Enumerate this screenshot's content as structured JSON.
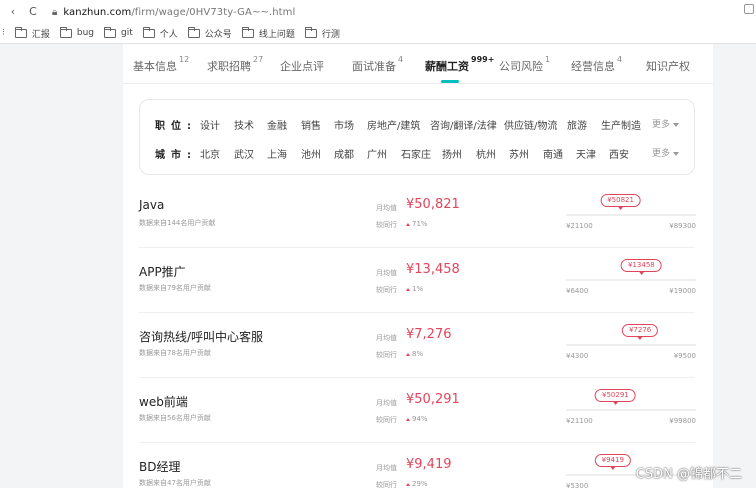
{
  "browser": {
    "back_glyph": "‹",
    "reload_glyph": "C",
    "url_host": "kanzhun.com",
    "url_path": "/firm/wage/0HV73ty-GA~~.html",
    "apps_label": "⁝",
    "bookmarks": [
      "汇报",
      "bug",
      "git",
      "个人",
      "公众号",
      "线上问题",
      "行测"
    ]
  },
  "tabs": [
    {
      "label": "基本信息",
      "count": "12"
    },
    {
      "label": "求职招聘",
      "count": "27"
    },
    {
      "label": "企业点评",
      "count": ""
    },
    {
      "label": "面试准备",
      "count": "4"
    },
    {
      "label": "薪酬工资",
      "count": "999+"
    },
    {
      "label": "公司风险",
      "count": "1"
    },
    {
      "label": "经营信息",
      "count": "4"
    },
    {
      "label": "知识产权",
      "count": ""
    }
  ],
  "active_tab_index": 4,
  "filters": {
    "position_label": "职位:",
    "positions": [
      "设计",
      "技术",
      "金融",
      "销售",
      "市场",
      "房地产/建筑",
      "咨询/翻译/法律",
      "供应链/物流",
      "旅游",
      "生产制造"
    ],
    "city_label": "城市:",
    "cities": [
      "北京",
      "武汉",
      "上海",
      "池州",
      "成都",
      "广州",
      "石家庄",
      "扬州",
      "杭州",
      "苏州",
      "南通",
      "天津",
      "西安"
    ],
    "more_label": "更多"
  },
  "salary_rows": [
    {
      "job": "Java",
      "source": "数据来自144名用户贡献",
      "avg_label": "月均值",
      "avg": "¥50,821",
      "yoy_label": "较同行",
      "yoy": "71%",
      "bubble": "¥50821",
      "min": "¥21100",
      "max": "¥89300",
      "level": 0.42
    },
    {
      "job": "APP推广",
      "source": "数据来自79名用户贡献",
      "avg_label": "月均值",
      "avg": "¥13,458",
      "yoy_label": "较同行",
      "yoy": "1%",
      "bubble": "¥13458",
      "min": "¥6400",
      "max": "¥19000",
      "level": 0.58
    },
    {
      "job": "咨询热线/呼叫中心客服",
      "source": "数据来自78名用户贡献",
      "avg_label": "月均值",
      "avg": "¥7,276",
      "yoy_label": "较同行",
      "yoy": "8%",
      "bubble": "¥7276",
      "min": "¥4300",
      "max": "¥9500",
      "level": 0.57
    },
    {
      "job": "web前端",
      "source": "数据来自56名用户贡献",
      "avg_label": "月均值",
      "avg": "¥50,291",
      "yoy_label": "较同行",
      "yoy": "94%",
      "bubble": "¥50291",
      "min": "¥21100",
      "max": "¥99800",
      "level": 0.38
    },
    {
      "job": "BD经理",
      "source": "数据来自47名用户贡献",
      "avg_label": "月均值",
      "avg": "¥9,419",
      "yoy_label": "较同行",
      "yoy": "29%",
      "bubble": "¥9419",
      "min": "¥5300",
      "max": "",
      "level": 0.36
    }
  ],
  "watermark": "CSDN @锦都不二",
  "colors": {
    "accent": "#00bebd",
    "salary": "#e0455b"
  }
}
